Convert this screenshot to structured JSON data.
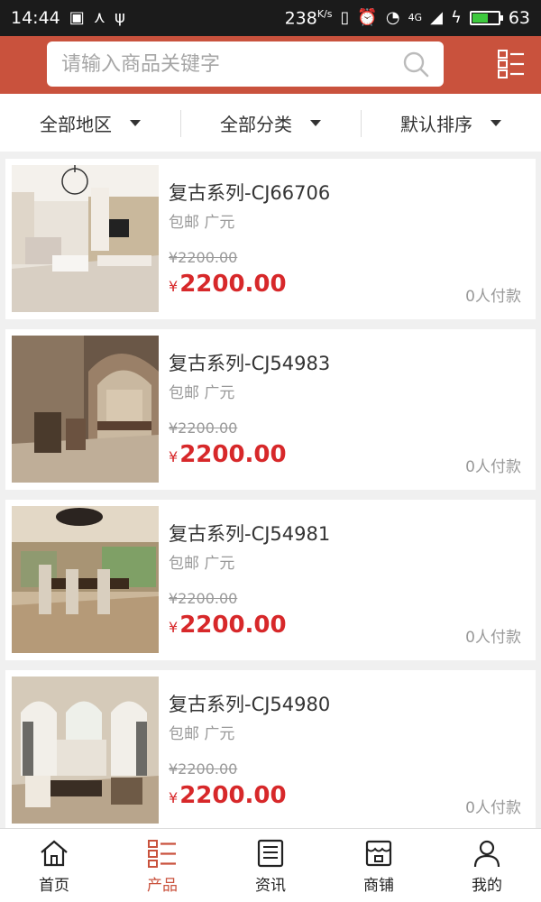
{
  "status_bar": {
    "time": "14:44",
    "net_speed": "238",
    "net_unit": "K/s",
    "battery": "63",
    "battery_level": 0.63,
    "signal_label": "4G"
  },
  "header": {
    "search_placeholder": "请输入商品关键字",
    "menu_icon": "list-menu-icon"
  },
  "filters": [
    {
      "label": "全部地区"
    },
    {
      "label": "全部分类"
    },
    {
      "label": "默认排序"
    }
  ],
  "products": [
    {
      "name": "复古系列-CJ66706",
      "meta": "包邮 广元",
      "old_price": "¥2200.00",
      "currency": "¥",
      "price": "2200.00",
      "sold": "0人付款",
      "scene": "living-room"
    },
    {
      "name": "复古系列-CJ54983",
      "meta": "包邮 广元",
      "old_price": "¥2200.00",
      "currency": "¥",
      "price": "2200.00",
      "sold": "0人付款",
      "scene": "arch-corridor"
    },
    {
      "name": "复古系列-CJ54981",
      "meta": "包邮 广元",
      "old_price": "¥2200.00",
      "currency": "¥",
      "price": "2200.00",
      "sold": "0人付款",
      "scene": "dining-room"
    },
    {
      "name": "复古系列-CJ54980",
      "meta": "包邮 广元",
      "old_price": "¥2200.00",
      "currency": "¥",
      "price": "2200.00",
      "sold": "0人付款",
      "scene": "grand-hall"
    }
  ],
  "nav": [
    {
      "label": "首页",
      "icon": "home-icon",
      "active": false
    },
    {
      "label": "产品",
      "icon": "list-icon",
      "active": true
    },
    {
      "label": "资讯",
      "icon": "news-icon",
      "active": false
    },
    {
      "label": "商铺",
      "icon": "shop-icon",
      "active": false
    },
    {
      "label": "我的",
      "icon": "user-icon",
      "active": false
    }
  ],
  "colors": {
    "brand": "#c9523d",
    "price": "#d7282a",
    "muted": "#999999"
  }
}
